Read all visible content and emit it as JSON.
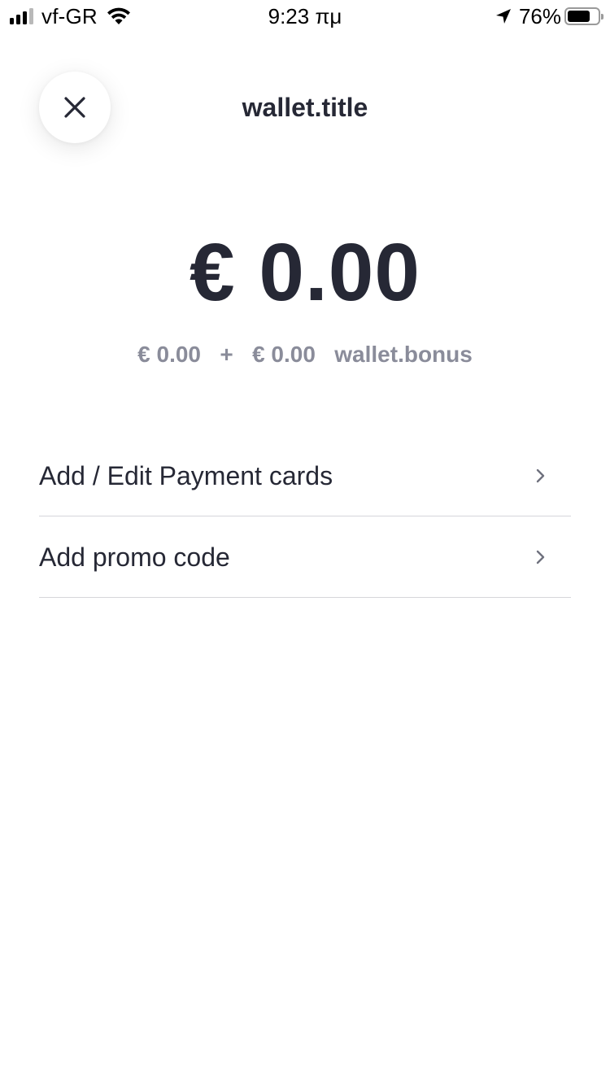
{
  "status_bar": {
    "carrier": "vf-GR",
    "time": "9:23 πμ",
    "battery_percent": "76%",
    "battery_level": 0.76,
    "signal_bars": 3,
    "signal_bars_total": 4
  },
  "header": {
    "title": "wallet.title",
    "close_icon": "close-icon"
  },
  "wallet": {
    "balance": "€ 0.00",
    "breakdown_main": "€ 0.00",
    "breakdown_plus": "+",
    "breakdown_bonus": "€ 0.00",
    "breakdown_bonus_label": "wallet.bonus"
  },
  "menu": {
    "items": [
      {
        "label": "Add / Edit Payment cards",
        "icon": "chevron-right-icon"
      },
      {
        "label": "Add promo code",
        "icon": "chevron-right-icon"
      }
    ]
  },
  "colors": {
    "text_primary": "#262835",
    "text_secondary": "#8a8c9a",
    "divider": "#d6d6da",
    "background": "#ffffff"
  }
}
